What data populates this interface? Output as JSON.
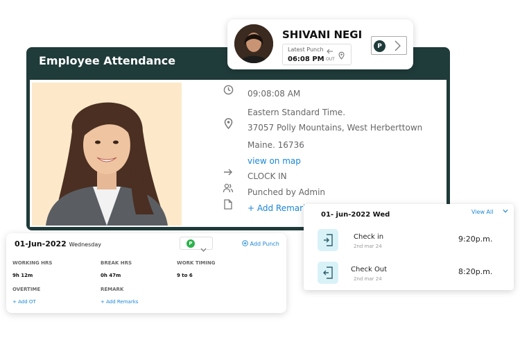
{
  "main": {
    "title": "Employee Attendance",
    "time": "09:08:08 AM",
    "timezone": "Eastern Standard Time.",
    "address_line1": "37057 Polly Mountains, West Herberttown",
    "address_line2": "Maine. 16736",
    "map_link": "view on map",
    "action": "CLOCK IN",
    "punched_by": "Punched by Admin",
    "add_remark": "+ Add Remark",
    "photo_bg": "#fde9c9",
    "header_color": "#1f3b3a"
  },
  "profile": {
    "name": "SHIVANI NEGI",
    "latest_punch_label": "Latest Punch",
    "latest_punch_time": "06:08 PM",
    "direction": "OUT",
    "status_badge": "P"
  },
  "day": {
    "date": "01-Jun-2022",
    "weekday": "Wednesday",
    "status": "P",
    "add_punch": "Add Punch",
    "working_hrs_label": "WORKING HRS",
    "working_hrs": "9h 12m",
    "break_hrs_label": "BREAK HRS",
    "break_hrs": "0h 47m",
    "work_timing_label": "WORK TIMING",
    "work_timing": "9 to 6",
    "overtime_label": "OVERTIME",
    "add_ot": "+ Add OT",
    "remark_label": "REMARK",
    "add_remarks": "+ Add Remarks"
  },
  "log": {
    "date": "01- jun-2022 Wed",
    "view_all": "View All",
    "entries": [
      {
        "type": "Check in",
        "date": "2nd mar 24",
        "time": "9:20p.m."
      },
      {
        "type": "Check Out",
        "date": "2nd mar 24",
        "time": "8:20p.m."
      }
    ]
  }
}
